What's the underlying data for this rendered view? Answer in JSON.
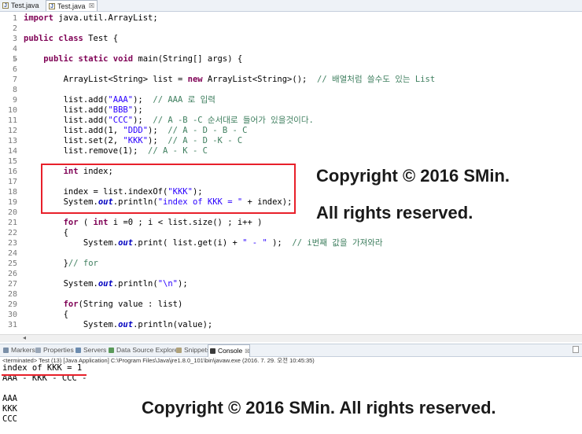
{
  "editor_tabs": [
    {
      "label": "Test.java"
    },
    {
      "label": "Test.java",
      "close": "☒"
    }
  ],
  "code_lines": [
    {
      "n": "1",
      "html": "<span class=\"kw\">import</span> java.util.ArrayList;"
    },
    {
      "n": "2",
      "html": ""
    },
    {
      "n": "3",
      "html": "<span class=\"kw\">public class</span> Test {"
    },
    {
      "n": "4",
      "html": ""
    },
    {
      "n": "5",
      "html": "    <span class=\"kw\">public static void</span> main(String[] args) {",
      "fold": true
    },
    {
      "n": "6",
      "html": ""
    },
    {
      "n": "7",
      "html": "        ArrayList&lt;String&gt; list = <span class=\"kw\">new</span> ArrayList&lt;String&gt;();  <span class=\"cm\">// 배열처럼 쓸수도 있는 List</span>"
    },
    {
      "n": "8",
      "html": ""
    },
    {
      "n": "9",
      "html": "        list.add(<span class=\"str\">\"AAA\"</span>);  <span class=\"cm\">// AAA 로 입력</span>"
    },
    {
      "n": "10",
      "html": "        list.add(<span class=\"str\">\"BBB\"</span>);"
    },
    {
      "n": "11",
      "html": "        list.add(<span class=\"str\">\"CCC\"</span>);  <span class=\"cm\">// A -B -C 순서대로 들어가 있을것이다.</span>"
    },
    {
      "n": "12",
      "html": "        list.add(1, <span class=\"str\">\"DDD\"</span>);  <span class=\"cm\">// A - D - B - C</span>"
    },
    {
      "n": "13",
      "html": "        list.set(2, <span class=\"str\">\"KKK\"</span>);  <span class=\"cm\">// A - D -K - C</span>"
    },
    {
      "n": "14",
      "html": "        list.remove(1);  <span class=\"cm\">// A - K - C</span>"
    },
    {
      "n": "15",
      "html": ""
    },
    {
      "n": "16",
      "html": "        <span class=\"kw\">int</span> index;"
    },
    {
      "n": "17",
      "html": ""
    },
    {
      "n": "18",
      "html": "        index = list.indexOf(<span class=\"str\">\"KKK\"</span>);"
    },
    {
      "n": "19",
      "html": "        System.<span class=\"st\">out</span>.println(<span class=\"str\">\"index of KKK = \"</span> + index);"
    },
    {
      "n": "20",
      "html": ""
    },
    {
      "n": "21",
      "html": "        <span class=\"kw\">for</span> ( <span class=\"kw\">int</span> i =0 ; i &lt; list.size() ; i++ )"
    },
    {
      "n": "22",
      "html": "        {"
    },
    {
      "n": "23",
      "html": "            System.<span class=\"st\">out</span>.print( list.get(i) + <span class=\"str\">\" - \"</span> );  <span class=\"cm\">// i번째 값을 가져와라</span>"
    },
    {
      "n": "24",
      "html": ""
    },
    {
      "n": "25",
      "html": "        }<span class=\"cm\">// for</span>"
    },
    {
      "n": "26",
      "html": ""
    },
    {
      "n": "27",
      "html": "        System.<span class=\"st\">out</span>.println(<span class=\"str\">\"\\n\"</span>);"
    },
    {
      "n": "28",
      "html": ""
    },
    {
      "n": "29",
      "html": "        <span class=\"kw\">for</span>(String value : list)"
    },
    {
      "n": "30",
      "html": "        {"
    },
    {
      "n": "31",
      "html": "            System.<span class=\"st\">out</span>.println(value);"
    }
  ],
  "watermark": {
    "line1": "Copyright © 2016 SMin.",
    "line2": "All rights reserved.",
    "console": "Copyright © 2016 SMin. All rights reserved."
  },
  "view_tabs": [
    {
      "label": "Markers",
      "icon_color": "#7a8fa8"
    },
    {
      "label": "Properties",
      "icon_color": "#9aa7b8"
    },
    {
      "label": "Servers",
      "icon_color": "#6c8cb0"
    },
    {
      "label": "Data Source Explorer",
      "icon_color": "#5a9a5a"
    },
    {
      "label": "Snippets",
      "icon_color": "#b0a27a"
    },
    {
      "label": "Console",
      "icon_color": "#3a3a3a",
      "close": "☒"
    }
  ],
  "console": {
    "terminated": "<terminated> Test (13) [Java Application] C:\\Program Files\\Java\\jre1.8.0_101\\bin\\javaw.exe (2016. 7. 29. 오전 10:45:35)",
    "lines": [
      "index of KKK = 1",
      "AAA - KKK - CCC -",
      "",
      "AAA",
      "KKK",
      "CCC"
    ]
  },
  "colors": {
    "annotation_red": "#e8202a",
    "keyword": "#7f0055",
    "string": "#2a00ff",
    "comment": "#3f7f5f"
  }
}
